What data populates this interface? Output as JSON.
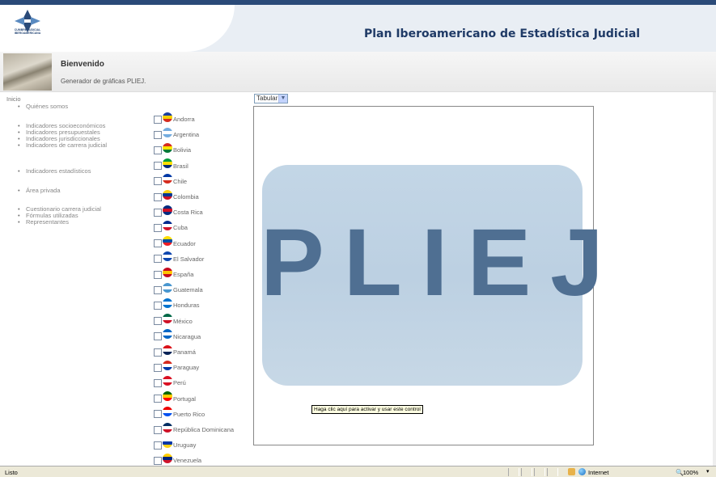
{
  "header": {
    "title": "Plan Iberoamericano de Estadística Judicial",
    "logo_text": "CUMBRE JUDICIAL IBEROAMERICANA"
  },
  "welcome": {
    "title": "Bienvenido",
    "subtitle": "Generador de gráficas PLIEJ."
  },
  "nav": {
    "home": "Inicio",
    "groups": [
      [
        "Quiénes somos"
      ],
      [
        "Indicadores socioeconómicos",
        "Indicadores presupuestales",
        "Indicadores jurisdiccionales",
        "Indicadores de carrera judicial"
      ],
      [
        "Indicadores estadísticos"
      ],
      [
        "Área privada"
      ],
      [
        "Cuestionario carrera judicial",
        "Fórmulas utilizadas",
        "Representantes"
      ]
    ]
  },
  "countries": [
    {
      "name": "Andorra",
      "flag": [
        "#1a3fa0",
        "#f5d000",
        "#d52b1e"
      ]
    },
    {
      "name": "Argentina",
      "flag": [
        "#74acdf",
        "#ffffff",
        "#74acdf"
      ]
    },
    {
      "name": "Bolivia",
      "flag": [
        "#d52b1e",
        "#f9e300",
        "#007934"
      ]
    },
    {
      "name": "Brasil",
      "flag": [
        "#009c3b",
        "#ffdf00",
        "#002776"
      ]
    },
    {
      "name": "Chile",
      "flag": [
        "#0039a6",
        "#ffffff",
        "#d52b1e"
      ]
    },
    {
      "name": "Colombia",
      "flag": [
        "#fcd116",
        "#003893",
        "#ce1126"
      ]
    },
    {
      "name": "Costa Rica",
      "flag": [
        "#002b7f",
        "#ce1126",
        "#002b7f"
      ]
    },
    {
      "name": "Cuba",
      "flag": [
        "#002a8f",
        "#ffffff",
        "#cf142b"
      ]
    },
    {
      "name": "Ecuador",
      "flag": [
        "#ffdd00",
        "#034ea2",
        "#ed1c24"
      ]
    },
    {
      "name": "El Salvador",
      "flag": [
        "#0f47af",
        "#ffffff",
        "#0f47af"
      ]
    },
    {
      "name": "España",
      "flag": [
        "#c60b1e",
        "#ffc400",
        "#c60b1e"
      ]
    },
    {
      "name": "Guatemala",
      "flag": [
        "#4997d0",
        "#ffffff",
        "#4997d0"
      ]
    },
    {
      "name": "Honduras",
      "flag": [
        "#0073cf",
        "#ffffff",
        "#0073cf"
      ]
    },
    {
      "name": "México",
      "flag": [
        "#006847",
        "#ffffff",
        "#ce1126"
      ]
    },
    {
      "name": "Nicaragua",
      "flag": [
        "#0067c6",
        "#ffffff",
        "#0067c6"
      ]
    },
    {
      "name": "Panamá",
      "flag": [
        "#da121a",
        "#ffffff",
        "#072357"
      ]
    },
    {
      "name": "Paraguay",
      "flag": [
        "#d52b1e",
        "#ffffff",
        "#0038a8"
      ]
    },
    {
      "name": "Perú",
      "flag": [
        "#d91023",
        "#ffffff",
        "#d91023"
      ]
    },
    {
      "name": "Portugal",
      "flag": [
        "#006600",
        "#ffcc00",
        "#ff0000"
      ]
    },
    {
      "name": "Puerto Rico",
      "flag": [
        "#ed0000",
        "#ffffff",
        "#0050f0"
      ]
    },
    {
      "name": "República Dominicana",
      "flag": [
        "#002d62",
        "#ffffff",
        "#ce1126"
      ]
    },
    {
      "name": "Uruguay",
      "flag": [
        "#ffffff",
        "#0038a8",
        "#fcd116"
      ]
    },
    {
      "name": "Venezuela",
      "flag": [
        "#ffcc00",
        "#00247d",
        "#cf142b"
      ]
    }
  ],
  "view_select": {
    "value": "Tabular"
  },
  "placeholder": {
    "logo_text": "PLIEJ"
  },
  "tooltip": "Haga clic aquí para activar y usar este control",
  "status_bar": {
    "status": "Listo",
    "zone": "Internet",
    "zoom": "100%"
  }
}
